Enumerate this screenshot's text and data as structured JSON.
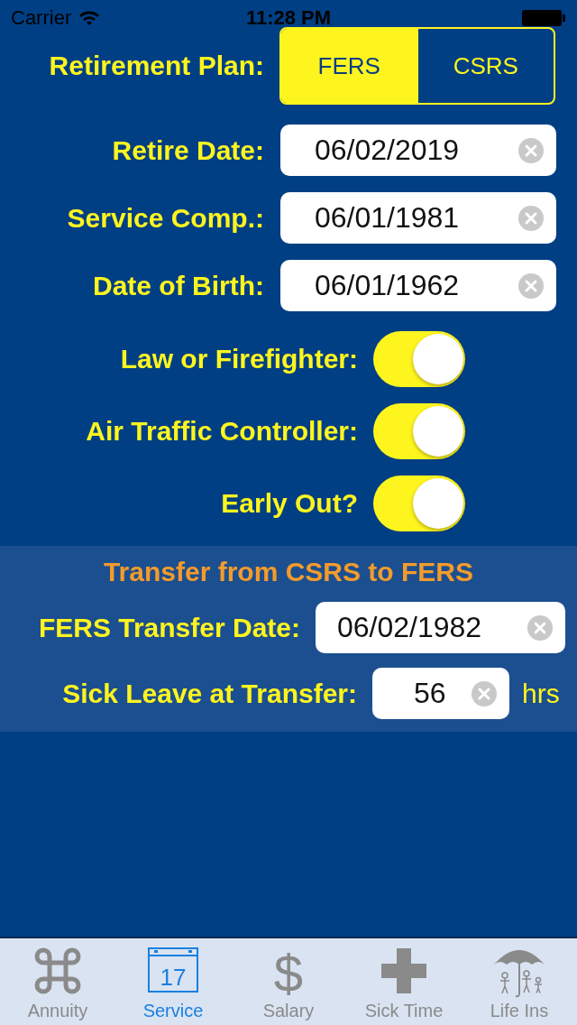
{
  "status_bar": {
    "carrier": "Carrier",
    "time": "11:28 PM"
  },
  "retirement_plan": {
    "label": "Retirement Plan:",
    "options": [
      {
        "label": "FERS",
        "selected": true
      },
      {
        "label": "CSRS",
        "selected": false
      }
    ]
  },
  "date_fields": [
    {
      "label": "Retire Date:",
      "value": "06/02/2019"
    },
    {
      "label": "Service Comp.:",
      "value": "06/01/1981"
    },
    {
      "label": "Date of Birth:",
      "value": "06/01/1962"
    }
  ],
  "toggles": [
    {
      "label": "Law or Firefighter:",
      "on": true
    },
    {
      "label": "Air Traffic Controller:",
      "on": true
    },
    {
      "label": "Early Out?",
      "on": true
    }
  ],
  "transfer": {
    "title": "Transfer from CSRS to FERS",
    "date": {
      "label": "FERS Transfer Date:",
      "value": "06/02/1982"
    },
    "sick_leave": {
      "label": "Sick Leave at Transfer:",
      "value": "56",
      "unit": "hrs"
    }
  },
  "tab_bar": [
    {
      "label": "Annuity",
      "kind": "command",
      "selected": false
    },
    {
      "label": "Service",
      "kind": "calendar",
      "icon_text": "17",
      "selected": true
    },
    {
      "label": "Salary",
      "kind": "dollar",
      "icon_text": "$",
      "selected": false
    },
    {
      "label": "Sick Time",
      "kind": "cross",
      "selected": false
    },
    {
      "label": "Life Ins",
      "kind": "umbrella",
      "selected": false
    }
  ]
}
